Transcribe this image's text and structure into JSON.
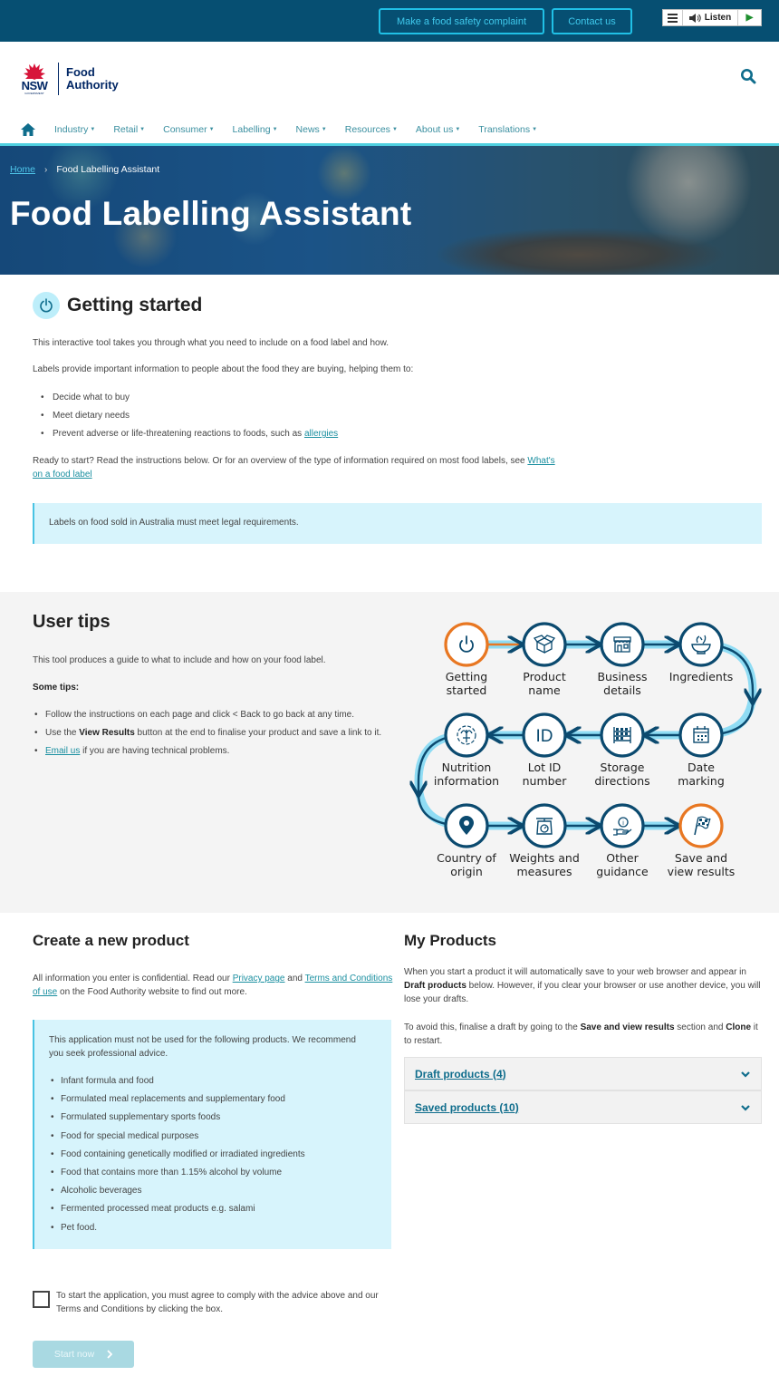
{
  "topbar": {
    "complaint_button": "Make a food safety complaint",
    "contact_button": "Contact us",
    "listen_label": "Listen"
  },
  "header": {
    "logo_nsw": "NSW",
    "logo_gov": "GOVERNMENT",
    "logo_line1": "Food",
    "logo_line2": "Authority"
  },
  "nav": {
    "items": [
      {
        "label": "Industry"
      },
      {
        "label": "Retail"
      },
      {
        "label": "Consumer"
      },
      {
        "label": "Labelling"
      },
      {
        "label": "News"
      },
      {
        "label": "Resources"
      },
      {
        "label": "About us"
      },
      {
        "label": "Translations"
      }
    ]
  },
  "breadcrumb": {
    "home": "Home",
    "separator": "›",
    "current": "Food Labelling Assistant"
  },
  "hero": {
    "title": "Food Labelling Assistant"
  },
  "getting_started": {
    "title": "Getting started",
    "p1": "This interactive tool takes you through what you need to include on a food label and how.",
    "p2": "Labels provide important information to people about the food they are buying, helping them to:",
    "bullets": [
      "Decide what to buy",
      "Meet dietary needs",
      "Prevent adverse or life-threatening reactions to foods, such as "
    ],
    "allergies_link": "allergies",
    "p3_text": "Ready to start? Read the instructions below. Or for an overview of the type of information required on most food labels, see ",
    "p3_link": "What's on a food label",
    "callout": "Labels on food sold in Australia must meet legal requirements."
  },
  "user_tips": {
    "title": "User tips",
    "intro": "This tool produces a guide to what to include and how on your food label.",
    "subheading": "Some tips:",
    "tip1": "Follow the instructions on each page and click < Back to go back at any time.",
    "tip2_pre": "Use the ",
    "tip2_bold": "View Results",
    "tip2_post": " button at the end to finalise your product and save a link to it.",
    "tip3_link": "Email us",
    "tip3_post": " if you are having technical problems."
  },
  "flow": {
    "steps": [
      {
        "line1": "Getting",
        "line2": "started",
        "icon": "power-icon",
        "highlight": true
      },
      {
        "line1": "Product",
        "line2": "name",
        "icon": "box-icon"
      },
      {
        "line1": "Business",
        "line2": "details",
        "icon": "shop-icon"
      },
      {
        "line1": "Ingredients",
        "line2": "",
        "icon": "bowl-icon"
      },
      {
        "line1": "Date",
        "line2": "marking",
        "icon": "calendar-icon"
      },
      {
        "line1": "Storage",
        "line2": "directions",
        "icon": "shelves-icon"
      },
      {
        "line1": "Lot ID",
        "line2": "number",
        "icon": "id-icon"
      },
      {
        "line1": "Nutrition",
        "line2": "information",
        "icon": "nutrition-icon"
      },
      {
        "line1": "Country of",
        "line2": "origin",
        "icon": "location-pin-icon"
      },
      {
        "line1": "Weights and",
        "line2": "measures",
        "icon": "scale-icon"
      },
      {
        "line1": "Other",
        "line2": "guidance",
        "icon": "info-hand-icon"
      },
      {
        "line1": "Save and",
        "line2": "view results",
        "icon": "checkered-flag-icon",
        "highlight": true
      }
    ],
    "colors": {
      "primary": "#0b4a6f",
      "accent": "#e87722",
      "glow": "#8fdcf4"
    }
  },
  "create": {
    "title": "Create a new product",
    "p_pre": "All information you enter is confidential. Read our ",
    "privacy_link": "Privacy page",
    "p_mid": " and ",
    "terms_link": "Terms and Conditions of use",
    "p_post": " on the Food Authority website to find out more.",
    "warning_intro": "This application must not be used for the following products. We recommend you seek professional advice.",
    "excluded": [
      "Infant formula and food",
      "Formulated meal replacements and supplementary food",
      "Formulated supplementary sports foods",
      "Food for special medical purposes",
      "Food containing genetically modified or irradiated ingredients",
      "Food that contains more than 1.15% alcohol by volume",
      "Alcoholic beverages",
      "Fermented processed meat products e.g. salami",
      "Pet food."
    ],
    "agree_text": "To start the application, you must agree to comply with the advice above and our Terms and Conditions by clicking the box.",
    "agree_checked": false,
    "start_button": "Start now"
  },
  "my_products": {
    "title": "My Products",
    "p1_pre": "When you start a product it will automatically save to your web browser and appear in ",
    "p1_bold": "Draft products",
    "p1_post": " below. However, if you clear your browser or use another device, you will lose your drafts.",
    "p2_pre": "To avoid this, finalise a draft by going to the ",
    "p2_bold1": "Save and view results",
    "p2_mid": " section and ",
    "p2_bold2": "Clone",
    "p2_post": " it to restart.",
    "draft_label": "Draft products (4)",
    "saved_label": "Saved products (10)"
  }
}
